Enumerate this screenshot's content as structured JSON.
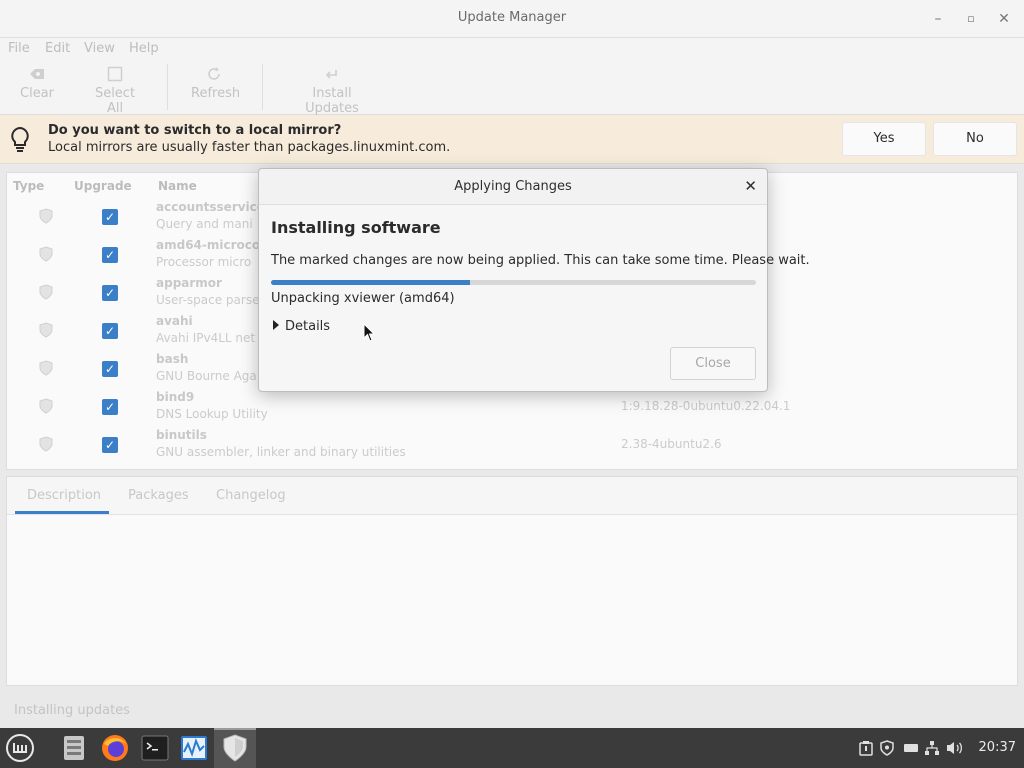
{
  "window": {
    "title": "Update Manager",
    "minimize_glyph": "–",
    "maximize_glyph": "▫",
    "close_glyph": "✕"
  },
  "menu": [
    "File",
    "Edit",
    "View",
    "Help"
  ],
  "toolbar": {
    "clear": {
      "label": "Clear",
      "icon": "eraser-icon"
    },
    "select_all": {
      "label": "Select All",
      "icon": "select-all-icon"
    },
    "refresh": {
      "label": "Refresh",
      "icon": "refresh-icon"
    },
    "install": {
      "label": "Install Updates",
      "icon": "install-icon"
    }
  },
  "infobar": {
    "question": "Do you want to switch to a local mirror?",
    "subtext": "Local mirrors are usually faster than packages.linuxmint.com.",
    "yes": "Yes",
    "no": "No"
  },
  "list": {
    "headers": {
      "type": "Type",
      "upgrade": "Upgrade",
      "name": "Name"
    },
    "rows": [
      {
        "name": "accountsservice",
        "desc": "Query and mani",
        "version": ""
      },
      {
        "name": "amd64-microco",
        "desc": "Processor micro",
        "version": ""
      },
      {
        "name": "apparmor",
        "desc": "User-space parse",
        "version": ""
      },
      {
        "name": "avahi",
        "desc": "Avahi IPv4LL net",
        "version": ""
      },
      {
        "name": "bash",
        "desc": "GNU Bourne Aga",
        "version": ""
      },
      {
        "name": "bind9",
        "desc": "DNS Lookup Utility",
        "version": "1:9.18.28-0ubuntu0.22.04.1"
      },
      {
        "name": "binutils",
        "desc": "GNU assembler, linker and binary utilities",
        "version": "2.38-4ubuntu2.6"
      }
    ]
  },
  "detail_tabs": [
    "Description",
    "Packages",
    "Changelog"
  ],
  "status": "Installing updates",
  "dialog": {
    "title": "Applying Changes",
    "close_glyph": "✕",
    "heading": "Installing software",
    "message": "The marked changes are now being applied. This can take some time. Please wait.",
    "progress": 0.41,
    "status": "Unpacking xviewer (amd64)",
    "details_label": "Details",
    "close_button": "Close"
  },
  "taskbar": {
    "clock": "20:37",
    "apps": [
      "menu-icon",
      "file-manager-icon",
      "firefox-icon",
      "terminal-icon",
      "system-monitor-icon",
      "update-manager-icon"
    ]
  },
  "colors": {
    "accent": "#3a7fc8",
    "infobar_bg": "#f7ecdc",
    "taskbar_bg": "#3b3b3b"
  }
}
